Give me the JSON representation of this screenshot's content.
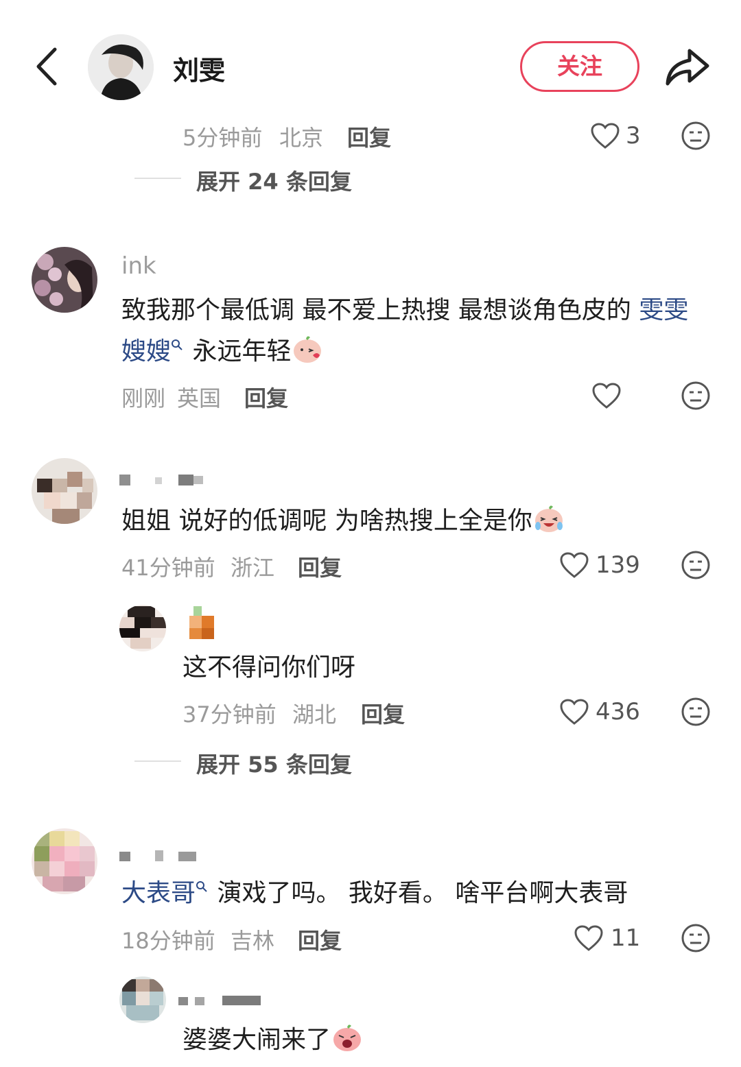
{
  "header": {
    "back_icon": "chevron-left-icon",
    "name": "刘雯",
    "follow_label": "关注",
    "share_icon": "share-arrow-icon",
    "accent_color": "#e8425b"
  },
  "comments": [
    {
      "meta_time": "5分钟前",
      "meta_location": "北京",
      "reply_label": "回复",
      "like_count": "3",
      "expand_label": "展开 24 条回复"
    },
    {
      "username": "ink",
      "content_part1": "致我那个最低调 最不爱上热搜 最想谈角色皮的 ",
      "mention": "雯雯嫂嫂",
      "content_part2": " 永远年轻",
      "meta_time": "刚刚",
      "meta_location": "英国",
      "reply_label": "回复",
      "like_count": ""
    },
    {
      "content": "姐姐 说好的低调呢 为啥热搜上全是你",
      "meta_time": "41分钟前",
      "meta_location": "浙江",
      "reply_label": "回复",
      "like_count": "139",
      "reply": {
        "content": "这不得问你们呀",
        "meta_time": "37分钟前",
        "meta_location": "湖北",
        "reply_label": "回复",
        "like_count": "436"
      },
      "expand_label": "展开 55 条回复"
    },
    {
      "mention": "大表哥",
      "content": " 演戏了吗。 我好看。 啥平台啊大表哥",
      "meta_time": "18分钟前",
      "meta_location": "吉林",
      "reply_label": "回复",
      "like_count": "11",
      "reply": {
        "content": "婆婆大闹来了"
      }
    }
  ],
  "colors": {
    "mention": "#2c4a86",
    "meta": "#9a9a9a"
  }
}
